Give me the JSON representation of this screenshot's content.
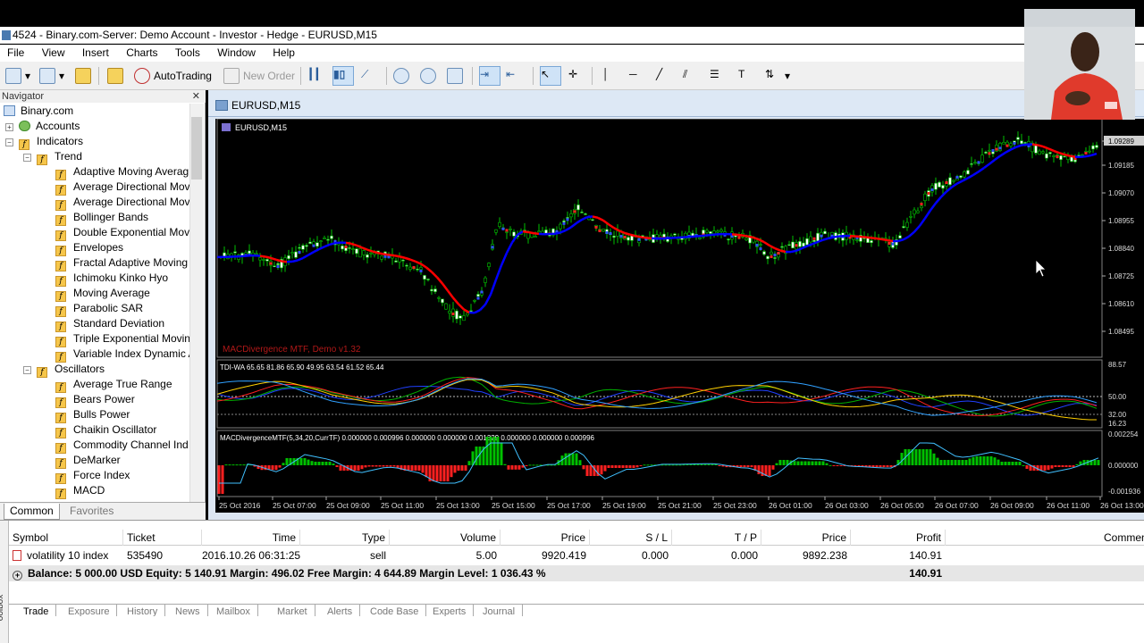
{
  "window": {
    "title": "4524 - Binary.com-Server: Demo Account - Investor - Hedge - EURUSD,M15"
  },
  "menu": [
    "File",
    "View",
    "Insert",
    "Charts",
    "Tools",
    "Window",
    "Help"
  ],
  "toolbar": {
    "autotrading_label": "AutoTrading",
    "new_order_label": "New Order"
  },
  "navigator": {
    "title": "Navigator",
    "tree": [
      {
        "label": "Binary.com",
        "level": 0,
        "kind": "root"
      },
      {
        "label": "Accounts",
        "level": 1,
        "kind": "accounts"
      },
      {
        "label": "Indicators",
        "level": 1,
        "kind": "folder"
      },
      {
        "label": "Trend",
        "level": 2,
        "kind": "folder"
      },
      {
        "label": "Adaptive Moving Averag",
        "level": 3,
        "kind": "indicator"
      },
      {
        "label": "Average Directional Move",
        "level": 3,
        "kind": "indicator"
      },
      {
        "label": "Average Directional Move",
        "level": 3,
        "kind": "indicator"
      },
      {
        "label": "Bollinger Bands",
        "level": 3,
        "kind": "indicator"
      },
      {
        "label": "Double Exponential Movi",
        "level": 3,
        "kind": "indicator"
      },
      {
        "label": "Envelopes",
        "level": 3,
        "kind": "indicator"
      },
      {
        "label": "Fractal Adaptive Moving",
        "level": 3,
        "kind": "indicator"
      },
      {
        "label": "Ichimoku Kinko Hyo",
        "level": 3,
        "kind": "indicator"
      },
      {
        "label": "Moving Average",
        "level": 3,
        "kind": "indicator"
      },
      {
        "label": "Parabolic SAR",
        "level": 3,
        "kind": "indicator"
      },
      {
        "label": "Standard Deviation",
        "level": 3,
        "kind": "indicator"
      },
      {
        "label": "Triple Exponential Movin",
        "level": 3,
        "kind": "indicator"
      },
      {
        "label": "Variable Index Dynamic A",
        "level": 3,
        "kind": "indicator"
      },
      {
        "label": "Oscillators",
        "level": 2,
        "kind": "folder"
      },
      {
        "label": "Average True Range",
        "level": 3,
        "kind": "indicator"
      },
      {
        "label": "Bears Power",
        "level": 3,
        "kind": "indicator"
      },
      {
        "label": "Bulls Power",
        "level": 3,
        "kind": "indicator"
      },
      {
        "label": "Chaikin Oscillator",
        "level": 3,
        "kind": "indicator"
      },
      {
        "label": "Commodity Channel Ind",
        "level": 3,
        "kind": "indicator"
      },
      {
        "label": "DeMarker",
        "level": 3,
        "kind": "indicator"
      },
      {
        "label": "Force Index",
        "level": 3,
        "kind": "indicator"
      },
      {
        "label": "MACD",
        "level": 3,
        "kind": "indicator"
      }
    ],
    "tabs": [
      "Common",
      "Favorites"
    ]
  },
  "chart": {
    "window_title": "EURUSD,M15",
    "symbol_label": "EURUSD,M15",
    "watermark": "MACDivergence MTF, Demo v1.32",
    "price_ticks": [
      "1.09289",
      "1.09185",
      "1.09070",
      "1.08955",
      "1.08840",
      "1.08725",
      "1.08610",
      "1.08495"
    ],
    "current_price": "1.09289",
    "tdi_label": "TDI-WA 65.65 81.86 65.90 49.95 63.54 61.52 65.44",
    "tdi_ticks": [
      "88.57",
      "50.00",
      "32.00",
      "16.23"
    ],
    "macd_label": "MACDivergenceMTF(5,34,20,CurrTF) 0.000000 0.000996 0.000000 0.000000 0.001329 0.000000 0.000000 0.000996",
    "macd_ticks": [
      "0.002254",
      "0.000000",
      "-0.001936"
    ],
    "time_ticks": [
      "25 Oct 2016",
      "25 Oct 07:00",
      "25 Oct 09:00",
      "25 Oct 11:00",
      "25 Oct 13:00",
      "25 Oct 15:00",
      "25 Oct 17:00",
      "25 Oct 19:00",
      "25 Oct 21:00",
      "25 Oct 23:00",
      "26 Oct 01:00",
      "26 Oct 03:00",
      "26 Oct 05:00",
      "26 Oct 07:00",
      "26 Oct 09:00",
      "26 Oct 11:00",
      "26 Oct 13:00"
    ],
    "colors": {
      "bull": "#00c000",
      "bear": "#ff2020",
      "ma_up": "#0000ff",
      "ma_down": "#ff0000"
    }
  },
  "terminal": {
    "columns": [
      "Symbol",
      "Ticket",
      "Time",
      "Type",
      "Volume",
      "Price",
      "S / L",
      "T / P",
      "Price",
      "Profit",
      "Commen"
    ],
    "row": {
      "symbol": "volatility 10 index",
      "ticket": "535490",
      "time": "2016.10.26 06:31:25",
      "type": "sell",
      "volume": "5.00",
      "price": "9920.419",
      "sl": "0.000",
      "tp": "0.000",
      "cur_price": "9892.238",
      "profit": "140.91"
    },
    "balance_line": "Balance: 5 000.00 USD  Equity: 5 140.91  Margin: 496.02  Free Margin: 4 644.89  Margin Level: 1 036.43 %",
    "balance_profit": "140.91",
    "tabs": [
      "Trade",
      "Exposure",
      "History",
      "News",
      "Mailbox",
      "Market",
      "Alerts",
      "Code Base",
      "Experts",
      "Journal"
    ],
    "side_label": "oolbox"
  }
}
